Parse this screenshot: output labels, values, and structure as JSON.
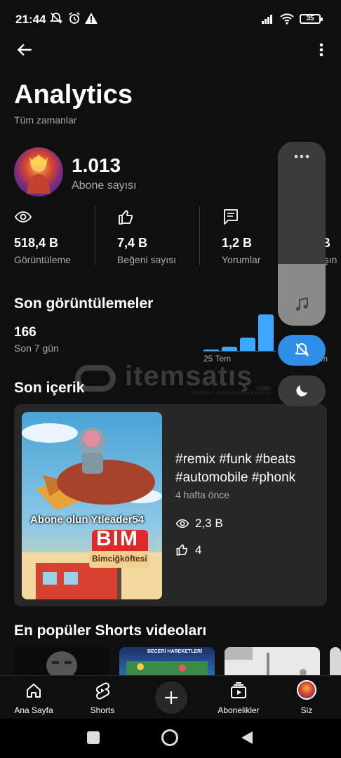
{
  "status_bar": {
    "time": "21:44",
    "battery": "35"
  },
  "header": {
    "title": "Analytics",
    "subtitle": "Tüm zamanlar"
  },
  "channel": {
    "subscribers": "1.013",
    "subscribers_label": "Abone sayısı"
  },
  "stats": [
    {
      "value": "518,4 B",
      "label": "Görüntüleme"
    },
    {
      "value": "7,4 B",
      "label": "Beğeni sayısı"
    },
    {
      "value": "1,2 B",
      "label": "Yorumlar"
    },
    {
      "value": "B",
      "label": "aşın"
    }
  ],
  "recent_views": {
    "title": "Son görüntülemeler",
    "value": "166",
    "period": "Son 7 gün",
    "axis_start": "25 Tem",
    "axis_end": "m"
  },
  "chart_data": {
    "type": "bar",
    "categories": [
      "",
      "",
      "",
      ""
    ],
    "values": [
      1,
      3,
      9,
      24
    ],
    "ylim": [
      0,
      26
    ],
    "xlabel": "",
    "ylabel": ""
  },
  "watermark": {
    "brand": "itemsatış",
    "tagline": "GÜVENLİ ALIŞVERİŞİN ADRESİ",
    "domain": ".com"
  },
  "latest_content": {
    "title": "Son içerik",
    "video_title": "#remix #funk #beats #automobile #phonk",
    "age": "4 hafta önce",
    "views": "2,3 B",
    "likes": "4",
    "thumb_text_1": "Abone olun Ytleader54",
    "thumb_text_2": "BIM",
    "thumb_text_3": "Bimciğköftesi"
  },
  "popular": {
    "title": "En popüler Shorts videoları",
    "short_2_caption": "BECERİ HAREKETLERİ"
  },
  "bottom_nav": [
    {
      "label": "Ana Sayfa",
      "icon": "home-icon"
    },
    {
      "label": "Shorts",
      "icon": "shorts-icon"
    },
    {
      "label": "",
      "icon": "create-icon"
    },
    {
      "label": "Abonelikler",
      "icon": "subscriptions-icon"
    },
    {
      "label": "Siz",
      "icon": "you-avatar"
    }
  ],
  "colors": {
    "accent": "#3ea6ff",
    "background": "#0f0f0f",
    "card": "#272727"
  }
}
